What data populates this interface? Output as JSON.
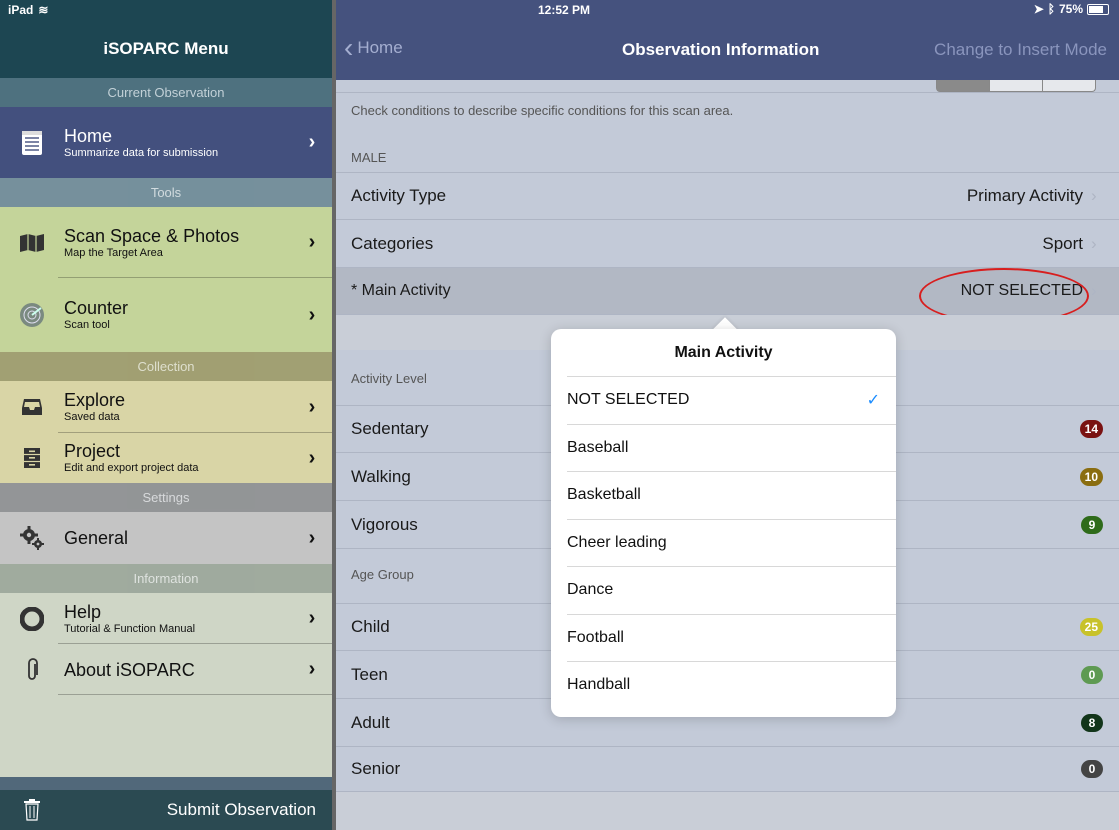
{
  "status_bar": {
    "device": "iPad",
    "time": "12:52 PM",
    "battery": "75%"
  },
  "sidebar": {
    "title": "iSOPARC Menu",
    "sections": {
      "current": "Current Observation",
      "tools": "Tools",
      "collection": "Collection",
      "settings": "Settings",
      "information": "Information"
    },
    "items": [
      {
        "title": "Home",
        "subtitle": "Summarize data for submission",
        "icon": "notepad-icon"
      },
      {
        "title": "Scan Space & Photos",
        "subtitle": "Map the Target Area",
        "icon": "map-icon"
      },
      {
        "title": "Counter",
        "subtitle": "Scan tool",
        "icon": "radar-icon"
      },
      {
        "title": "Explore",
        "subtitle": "Saved data",
        "icon": "inbox-tray-icon"
      },
      {
        "title": "Project",
        "subtitle": "Edit and export project data",
        "icon": "file-cabinet-icon"
      },
      {
        "title": "General",
        "subtitle": "",
        "icon": "gears-icon"
      },
      {
        "title": "Help",
        "subtitle": "Tutorial & Function Manual",
        "icon": "lifebuoy-icon"
      },
      {
        "title": "About iSOPARC",
        "subtitle": "",
        "icon": "paperclip-icon"
      }
    ],
    "footer": "Submit Observation"
  },
  "nav": {
    "back": "Home",
    "title": "Observation Information",
    "action": "Change to Insert Mode"
  },
  "main": {
    "description": "Check conditions to describe specific conditions for this scan area.",
    "group_male": "MALE",
    "activity_type": {
      "label": "Activity Type",
      "value": "Primary Activity"
    },
    "categories": {
      "label": "Categories",
      "value": "Sport"
    },
    "main_activity": {
      "label": "* Main Activity",
      "value": "NOT SELECTED"
    },
    "activity_level_header": "Activity Level",
    "activity_levels": [
      {
        "label": "Sedentary",
        "count": "14",
        "color": "#7a1212"
      },
      {
        "label": "Walking",
        "count": "10",
        "color": "#8a6d10"
      },
      {
        "label": "Vigorous",
        "count": "9",
        "color": "#2e6b1a"
      }
    ],
    "age_group_header": "Age Group",
    "age_groups": [
      {
        "label": "Child",
        "count": "25",
        "color": "#c8c22a"
      },
      {
        "label": "Teen",
        "count": "0",
        "color": "#5e9a52"
      },
      {
        "label": "Adult",
        "count": "8",
        "color": "#12351a"
      },
      {
        "label": "Senior",
        "count": "0",
        "color": "#444444"
      }
    ]
  },
  "popover": {
    "title": "Main Activity",
    "options": [
      "NOT SELECTED",
      "Baseball",
      "Basketball",
      "Cheer leading",
      "Dance",
      "Football",
      "Handball"
    ],
    "selected": "NOT SELECTED"
  },
  "colors": {
    "sidebar_header": "#1d4652",
    "sidebar_section": "#5f7d87",
    "home_item": "#43507e",
    "tools_item": "#c4d49a",
    "collection_item": "#d9d5a6",
    "settings_item": "#c4c4c4",
    "info_item": "#cfd6c6",
    "main_bg": "#c3cad8",
    "nav_bg": "#45527e",
    "highlight_circle": "#d81e1e",
    "checkmark": "#1a8cff"
  }
}
